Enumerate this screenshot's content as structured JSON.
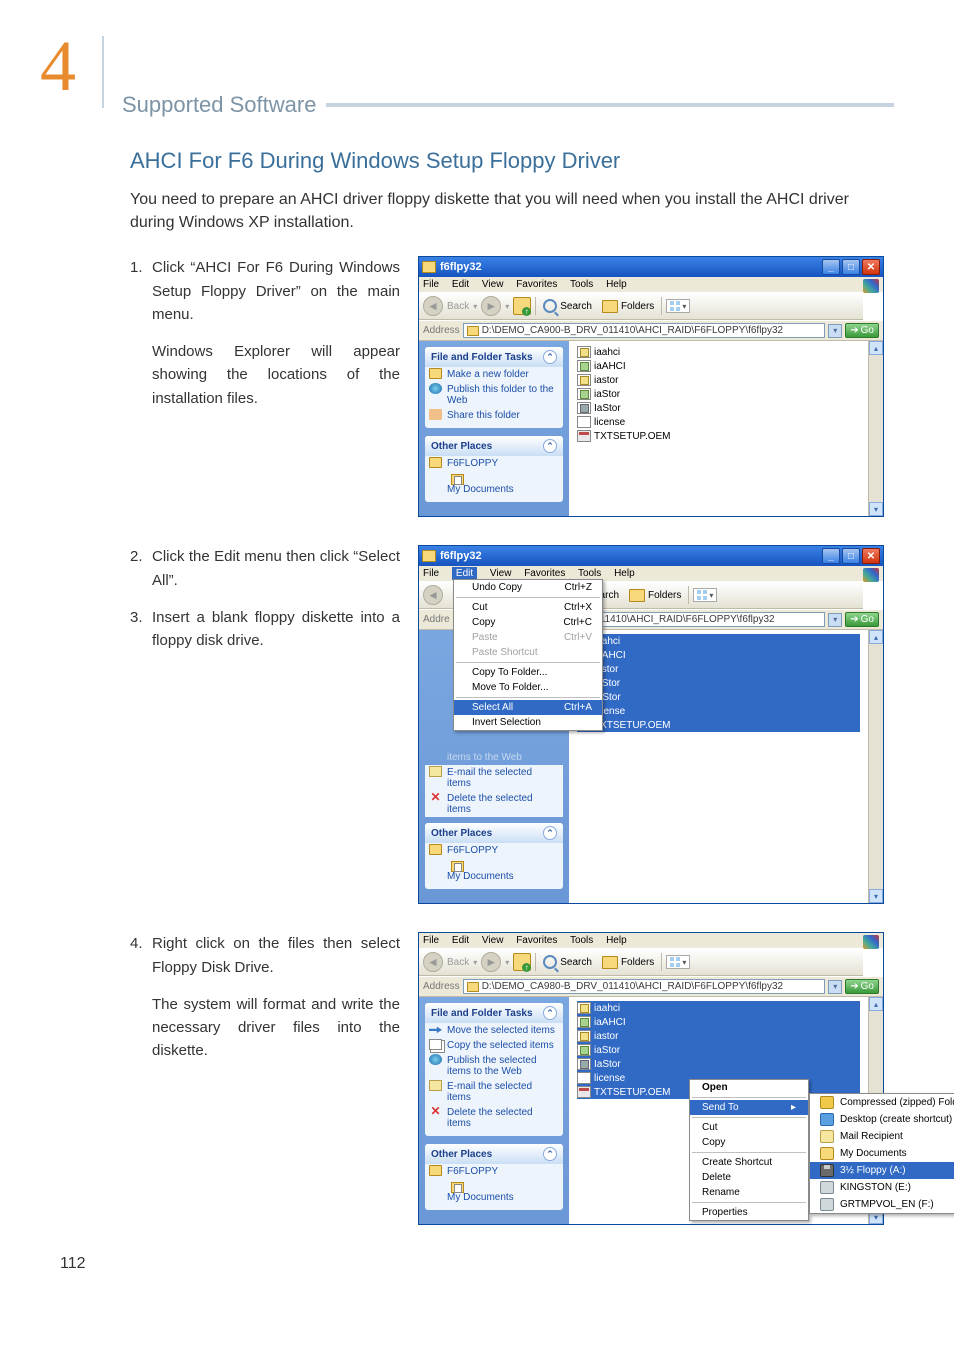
{
  "chapter_number": "4",
  "section_title": "Supported Software",
  "heading": "AHCI For F6 During Windows Setup Floppy Driver",
  "intro": "You need to prepare an AHCI driver floppy diskette that you will need when you install the AHCI driver during Windows XP installation.",
  "steps": {
    "s1": {
      "num": "1.",
      "text": "Click “AHCI For F6 During Windows Setup Floppy Driver” on the main menu.",
      "follow": "Windows Explorer will appear showing the locations of the installation files."
    },
    "s2": {
      "num": "2.",
      "text": "Click the Edit menu then click “Select All”."
    },
    "s3": {
      "num": "3.",
      "text": "Insert a blank floppy diskette into a floppy disk drive."
    },
    "s4": {
      "num": "4.",
      "text": "Right click on the files then select Floppy Disk Drive.",
      "follow": "The system will format and write the necessary driver files into the diskette."
    }
  },
  "menubar": {
    "file": "File",
    "edit": "Edit",
    "view": "View",
    "favorites": "Favorites",
    "tools": "Tools",
    "help": "Help"
  },
  "toolbar": {
    "back": "Back",
    "search": "Search",
    "folders": "Folders"
  },
  "addr": {
    "label": "Address",
    "go": "Go",
    "path1": "D:\\DEMO_CA900-B_DRV_011410\\AHCI_RAID\\F6FLOPPY\\f6flpy32",
    "path2": "11410\\AHCI_RAID\\F6FLOPPY\\f6flpy32",
    "path3": "D:\\DEMO_CA980-B_DRV_011410\\AHCI_RAID\\F6FLOPPY\\f6flpy32"
  },
  "win_title": "f6flpy32",
  "panels": {
    "tasks_head": "File and Folder Tasks",
    "other_head": "Other Places",
    "tasks1": {
      "a": "Make a new folder",
      "b": "Publish this folder to the Web",
      "c": "Share this folder"
    },
    "tasks3": {
      "a": "Move the selected items",
      "b": "Copy the selected items",
      "c": "Publish the selected items to the Web",
      "d": "E-mail the selected items",
      "e": "Delete the selected items"
    },
    "tasks2extra": {
      "a": "items to the Web",
      "b": "E-mail the selected items",
      "c": "Delete the selected items"
    },
    "other": {
      "a": "F6FLOPPY",
      "b": "My Documents"
    }
  },
  "files": {
    "iaahci": "iaahci",
    "iaAHCI": "iaAHCI",
    "iastor": "iastor",
    "iaStor": "iaStor",
    "IaStor": "IaStor",
    "license": "license",
    "txtsetup": "TXTSETUP.OEM"
  },
  "editmenu": {
    "undo": "Undo Copy",
    "undo_k": "Ctrl+Z",
    "cut": "Cut",
    "cut_k": "Ctrl+X",
    "copy": "Copy",
    "copy_k": "Ctrl+C",
    "paste": "Paste",
    "paste_k": "Ctrl+V",
    "pastesc": "Paste Shortcut",
    "copyto": "Copy To Folder...",
    "moveto": "Move To Folder...",
    "selectall": "Select All",
    "selectall_k": "Ctrl+A",
    "invert": "Invert Selection"
  },
  "ctxmenu": {
    "open": "Open",
    "sendto": "Send To",
    "cut": "Cut",
    "copy": "Copy",
    "shortcut": "Create Shortcut",
    "delete": "Delete",
    "rename": "Rename",
    "props": "Properties"
  },
  "sendto": {
    "zip": "Compressed (zipped) Folder",
    "desk": "Desktop (create shortcut)",
    "mail": "Mail Recipient",
    "docs": "My Documents",
    "floppy": "3½ Floppy (A:)",
    "king": "KINGSTON (E:)",
    "grt": "GRTMPVOL_EN (F:)"
  },
  "page_number": "112"
}
